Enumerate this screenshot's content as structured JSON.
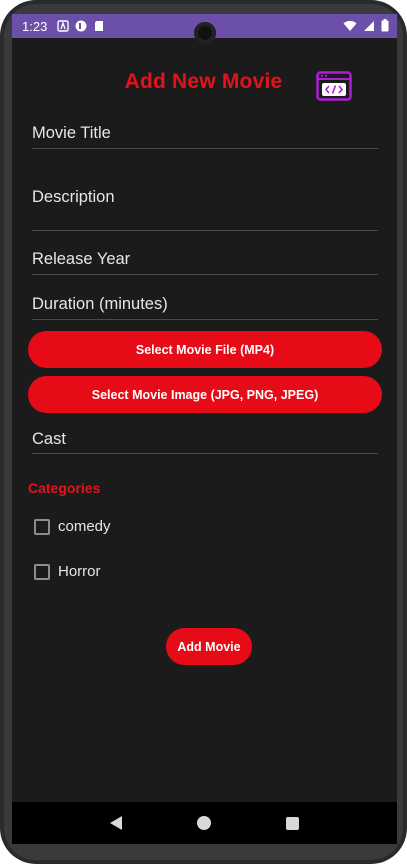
{
  "status_bar": {
    "time": "1:23"
  },
  "header": {
    "title": "Add New Movie"
  },
  "fields": {
    "movie_title": "Movie Title",
    "description": "Description",
    "release_year": "Release Year",
    "duration": "Duration (minutes)",
    "cast": "Cast"
  },
  "buttons": {
    "select_file": "Select Movie File (MP4)",
    "select_image": "Select Movie Image (JPG, PNG, JPEG)",
    "add_movie": "Add Movie"
  },
  "categories": {
    "label": "Categories",
    "items": [
      {
        "label": "comedy",
        "checked": false
      },
      {
        "label": "Horror",
        "checked": false
      }
    ]
  },
  "colors": {
    "accent": "#e60b16",
    "background": "#1b1b1c",
    "status_bar": "#6b4fa8"
  },
  "icons": [
    "code-window-icon",
    "wifi-icon",
    "signal-icon",
    "battery-icon",
    "back-icon",
    "home-icon",
    "recents-icon"
  ]
}
